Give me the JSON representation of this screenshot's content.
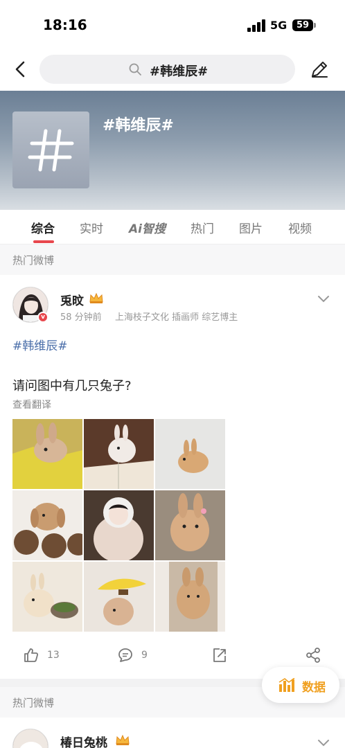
{
  "status_bar": {
    "time": "18:16",
    "network": "5G",
    "battery": "59"
  },
  "nav": {
    "search_text": "#韩维辰#"
  },
  "banner": {
    "title": "#韩维辰#",
    "thumb_glyph": "#"
  },
  "tabs": [
    {
      "label": "综合",
      "active": true
    },
    {
      "label": "实时"
    },
    {
      "label": "Ai智搜"
    },
    {
      "label": "热门"
    },
    {
      "label": "图片"
    },
    {
      "label": "视频"
    }
  ],
  "sections": {
    "hot_label_1": "热门微博",
    "hot_label_2": "热门微博"
  },
  "post": {
    "username": "兎旼",
    "time": "58 分钟前",
    "meta_info": "上海枝子文化 插画师 综艺博主",
    "hashtag": "#韩维辰#",
    "text": "请问图中有几只兔子?",
    "translate": "查看翻译",
    "likes": "13",
    "comments": "9"
  },
  "post2": {
    "username": "椿日兔桃"
  },
  "data_button": {
    "label": "数据"
  },
  "colors": {
    "accent": "#e8474d",
    "link": "#4a6ea9",
    "data_orange": "#f0a020"
  },
  "icons": [
    "back-arrow-icon",
    "search-icon",
    "edit-pencil-icon",
    "crown-icon",
    "chevron-down-icon",
    "like-icon",
    "comment-icon",
    "share-icon",
    "forward-icon",
    "bar-chart-icon"
  ]
}
